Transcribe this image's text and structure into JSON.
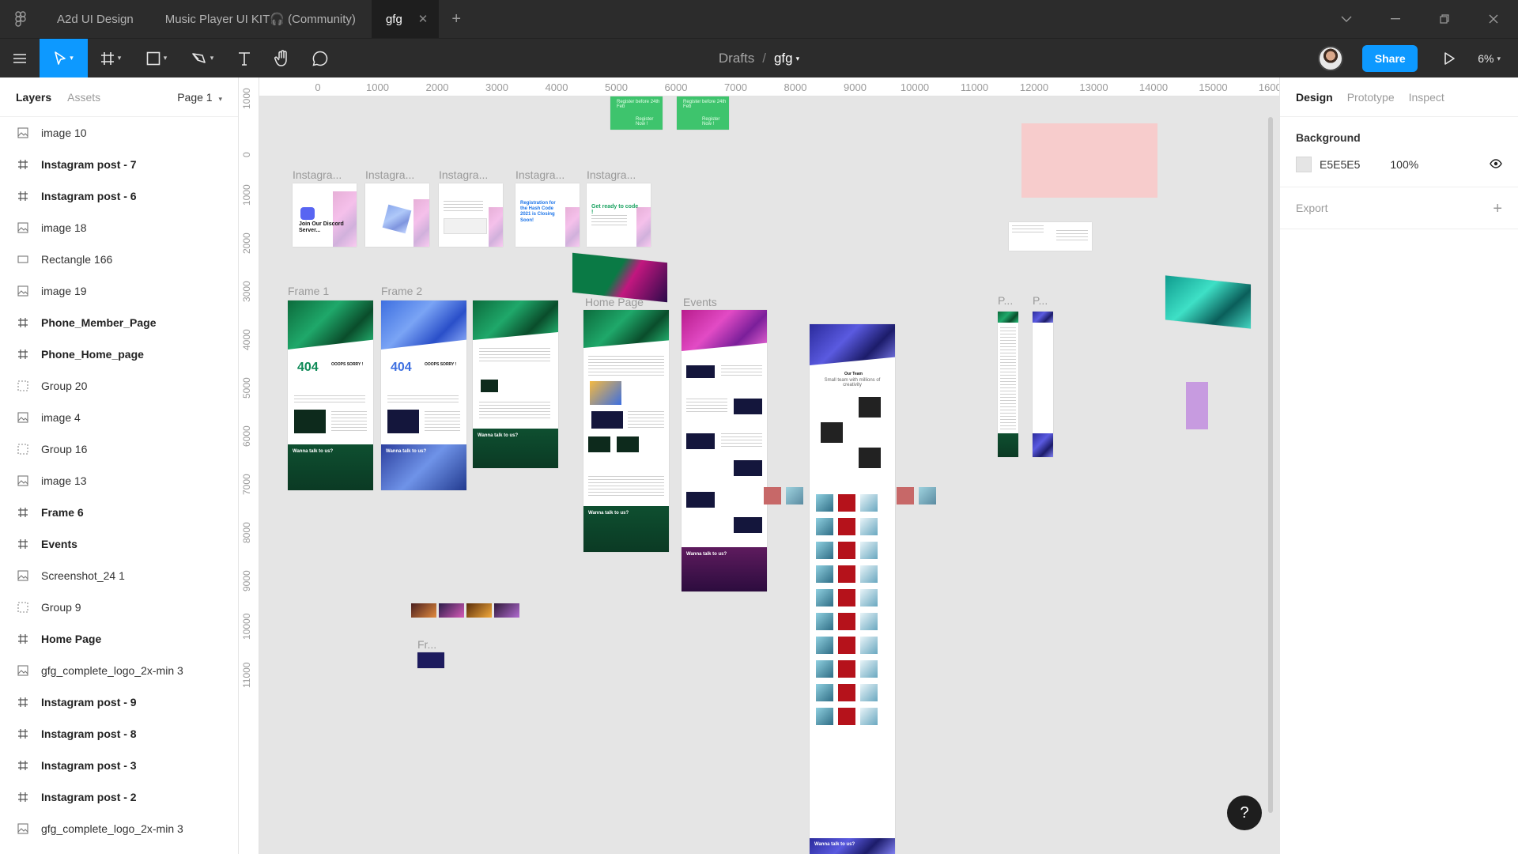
{
  "titlebar": {
    "tabs": [
      {
        "label": "A2d UI Design"
      },
      {
        "label": "Music Player UI KIT🎧 (Community)"
      },
      {
        "label": "gfg"
      }
    ]
  },
  "toolbar": {
    "breadcrumb_parent": "Drafts",
    "breadcrumb_sep": "/",
    "file_name": "gfg",
    "share_label": "Share",
    "zoom": "6%"
  },
  "left_panel": {
    "tab_layers": "Layers",
    "tab_assets": "Assets",
    "page_label": "Page 1",
    "layers": [
      {
        "name": "image 10",
        "type": "image"
      },
      {
        "name": "Instagram post - 7",
        "type": "frame"
      },
      {
        "name": "Instagram post - 6",
        "type": "frame"
      },
      {
        "name": "image 18",
        "type": "image"
      },
      {
        "name": "Rectangle 166",
        "type": "rectangle"
      },
      {
        "name": "image 19",
        "type": "image"
      },
      {
        "name": "Phone_Member_Page",
        "type": "frame"
      },
      {
        "name": "Phone_Home_page",
        "type": "frame"
      },
      {
        "name": "Group 20",
        "type": "group"
      },
      {
        "name": "image 4",
        "type": "image"
      },
      {
        "name": "Group 16",
        "type": "group"
      },
      {
        "name": "image 13",
        "type": "image"
      },
      {
        "name": "Frame 6",
        "type": "frame"
      },
      {
        "name": "Events",
        "type": "frame"
      },
      {
        "name": "Screenshot_24 1",
        "type": "image"
      },
      {
        "name": "Group 9",
        "type": "group"
      },
      {
        "name": "Home Page",
        "type": "frame"
      },
      {
        "name": "gfg_complete_logo_2x-min 3",
        "type": "image"
      },
      {
        "name": "Instagram post - 9",
        "type": "frame"
      },
      {
        "name": "Instagram post - 8",
        "type": "frame"
      },
      {
        "name": "Instagram post - 3",
        "type": "frame"
      },
      {
        "name": "Instagram post - 2",
        "type": "frame"
      },
      {
        "name": "gfg_complete_logo_2x-min 3",
        "type": "image"
      }
    ]
  },
  "canvas": {
    "ruler_x": [
      "0",
      "1000",
      "2000",
      "3000",
      "4000",
      "5000",
      "6000",
      "7000",
      "8000",
      "9000",
      "10000",
      "11000",
      "12000",
      "13000",
      "14000",
      "15000",
      "16000"
    ],
    "ruler_y": [
      "1000",
      "0",
      "1000",
      "2000",
      "3000",
      "4000",
      "5000",
      "6000",
      "7000",
      "8000",
      "9000",
      "10000",
      "11000"
    ],
    "frame_labels": {
      "insta1": "Instagra...",
      "insta2": "Instagra...",
      "insta3": "Instagra...",
      "insta4": "Instagra...",
      "insta5": "Instagra...",
      "frame1": "Frame 1",
      "frame2": "Frame 2",
      "home": "Home Page",
      "events": "Events",
      "p1": "P...",
      "p2": "P...",
      "fr": "Fr..."
    },
    "frame_texts": {
      "err404": "404",
      "oops": "OOOPS SORRY !",
      "insta_discord": "Join Our Discord Server...",
      "insta_reg": "Registration for the Hash Code 2021 is Closing Soon!",
      "insta_ready": "Get ready to code !",
      "wanna_talk": "Wanna talk to us?",
      "register_banner": "Register before 24th Feb",
      "register_now": "Register Now !",
      "team_heading": "Our Team",
      "team_sub": "Small team with millions of creativity"
    }
  },
  "right_panel": {
    "tab_design": "Design",
    "tab_prototype": "Prototype",
    "tab_inspect": "Inspect",
    "background_heading": "Background",
    "background_hex": "E5E5E5",
    "background_opacity": "100%",
    "export_heading": "Export",
    "colors": {
      "background": "#E5E5E5",
      "accent": "#0D99FF"
    }
  },
  "help_label": "?"
}
